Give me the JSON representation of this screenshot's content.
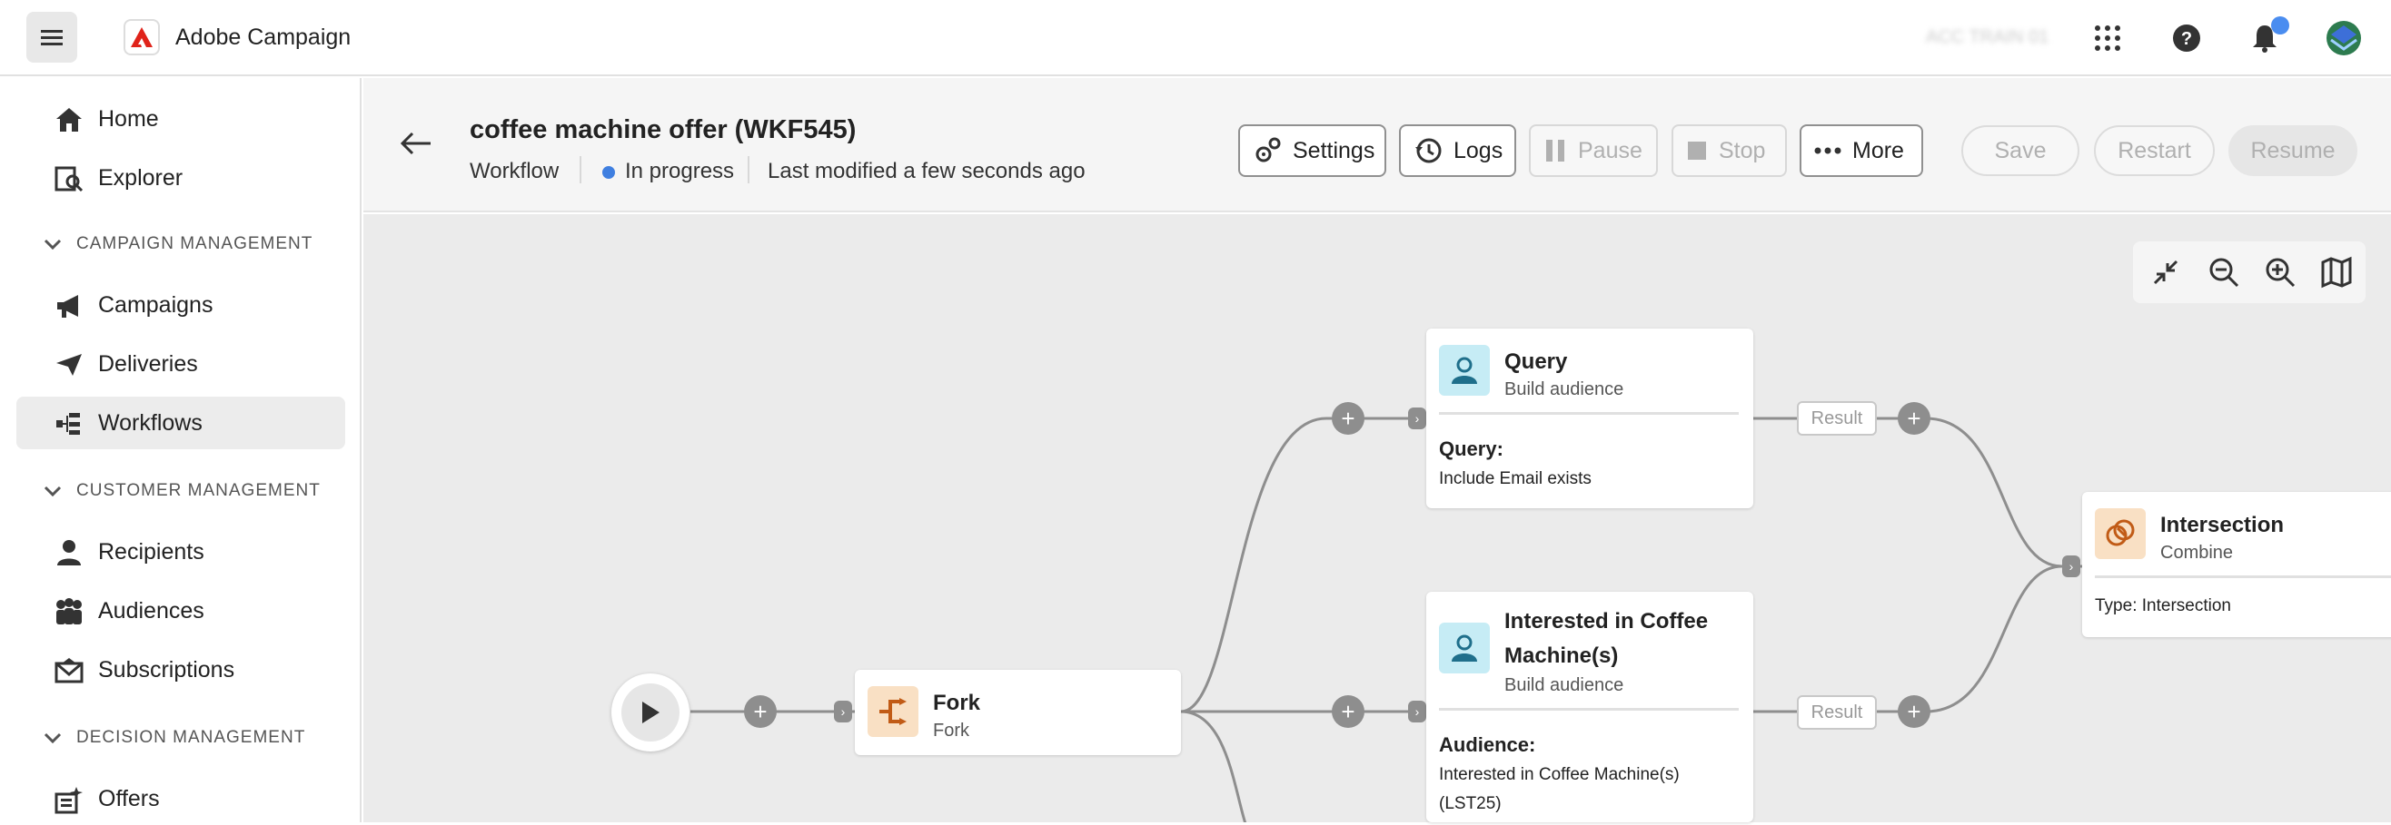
{
  "app": {
    "name": "Adobe Campaign",
    "blurred_user": "ACC TRAIN 01"
  },
  "topbar": {
    "icons": [
      "menu-icon",
      "apps-grid-icon",
      "help-icon",
      "bell-icon",
      "avatar"
    ]
  },
  "sidebar": {
    "items": [
      {
        "label": "Home",
        "icon": "home-icon"
      },
      {
        "label": "Explorer",
        "icon": "explorer-icon"
      },
      {
        "label": "Campaigns",
        "icon": "megaphone-icon"
      },
      {
        "label": "Deliveries",
        "icon": "send-icon"
      },
      {
        "label": "Workflows",
        "icon": "workflow-icon"
      },
      {
        "label": "Recipients",
        "icon": "person-icon"
      },
      {
        "label": "Audiences",
        "icon": "group-icon"
      },
      {
        "label": "Subscriptions",
        "icon": "envelope-icon"
      },
      {
        "label": "Offers",
        "icon": "offer-icon"
      }
    ],
    "sections": [
      "CAMPAIGN MANAGEMENT",
      "CUSTOMER MANAGEMENT",
      "DECISION MANAGEMENT"
    ],
    "active": "Workflows"
  },
  "header": {
    "title": "coffee machine offer (WKF545)",
    "type": "Workflow",
    "status": "In progress",
    "modified": "Last modified a few seconds ago",
    "status_color": "#3f7fe0",
    "buttons": {
      "settings": "Settings",
      "logs": "Logs",
      "pause": "Pause",
      "stop": "Stop",
      "more": "More",
      "save": "Save",
      "restart": "Restart",
      "resume": "Resume"
    }
  },
  "workflow": {
    "fork": {
      "title": "Fork",
      "subtitle": "Fork"
    },
    "query": {
      "title": "Query",
      "subtitle": "Build audience",
      "label": "Query:",
      "value": "Include Email exists"
    },
    "interested": {
      "title_line1": "Interested in Coffee",
      "title_line2": "Machine(s)",
      "subtitle": "Build audience",
      "label": "Audience:",
      "value_line1": "Interested in Coffee Machine(s)",
      "value_line2": "(LST25)"
    },
    "intersection": {
      "title": "Intersection",
      "subtitle": "Combine",
      "value": "Type: Intersection"
    },
    "result_label": "Result"
  }
}
